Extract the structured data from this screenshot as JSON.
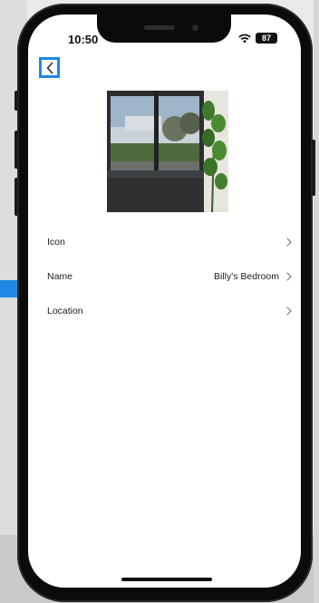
{
  "status_bar": {
    "time": "10:50",
    "battery": "87"
  },
  "settings": {
    "rows": [
      {
        "label": "Icon",
        "value": ""
      },
      {
        "label": "Name",
        "value": "Billy's Bedroom"
      },
      {
        "label": "Location",
        "value": ""
      }
    ]
  },
  "colors": {
    "highlight": "#1e88e5",
    "phone_body": "#0b0b0c",
    "screen": "#ffffff"
  },
  "icons": {
    "back": "chevron-left-icon",
    "row": "chevron-right-icon",
    "wifi": "wifi-icon"
  }
}
